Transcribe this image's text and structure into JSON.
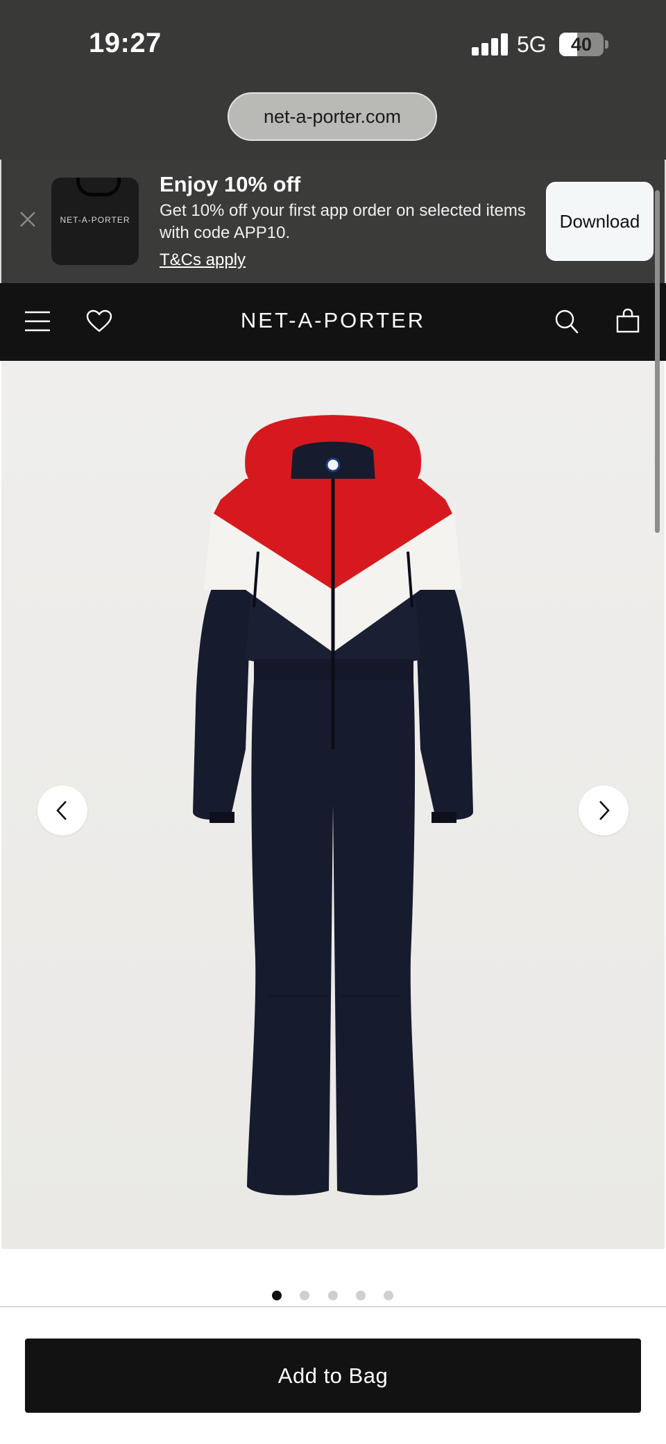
{
  "status_bar": {
    "time": "19:27",
    "network": "5G",
    "battery": "40",
    "battery_level_percent": 40,
    "url": "net-a-porter.com"
  },
  "promo": {
    "close_icon": "close-icon",
    "app_icon_text": "NET-A-PORTER",
    "title": "Enjoy 10% off",
    "body": "Get 10% off your first app order on selected items with code APP10.",
    "link": "T&Cs apply",
    "download_label": "Download"
  },
  "header": {
    "logo": "NET-A-PORTER",
    "icons": [
      "menu-icon",
      "heart-icon",
      "search-icon",
      "shopping-bag-icon"
    ]
  },
  "product": {
    "image_icon": "ski-suit-image",
    "prev_icon": "chevron-left-icon",
    "next_icon": "chevron-right-icon",
    "image_count": 5,
    "active_image": 1
  },
  "actions": {
    "add_to_bag_label": "Add to Bag"
  },
  "colors": {
    "chrome": "#393a38",
    "header_bg": "#121212",
    "suit_red": "#d5191f",
    "suit_navy": "#171c2e",
    "suit_white": "#f4f3ef"
  }
}
